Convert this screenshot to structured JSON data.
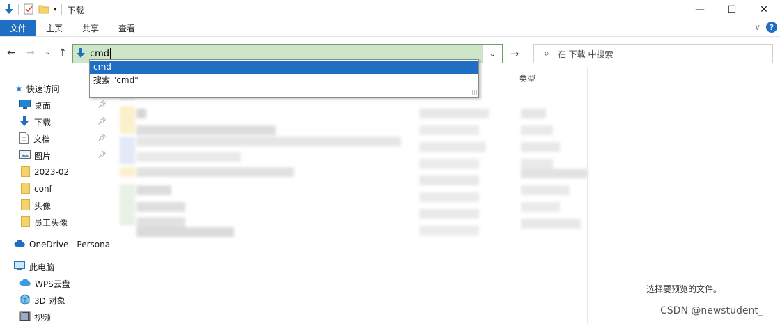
{
  "window": {
    "title": "下载",
    "controls": {
      "minimize": "—",
      "maximize": "☐",
      "close": "✕"
    }
  },
  "ribbon": {
    "tabs": [
      {
        "label": "文件"
      },
      {
        "label": "主页"
      },
      {
        "label": "共享"
      },
      {
        "label": "查看"
      }
    ],
    "expand": "∨",
    "help": "?"
  },
  "nav": {
    "back": "←",
    "forward": "→",
    "recent": "⌄",
    "up": "↑",
    "address_value": "cmd",
    "address_dropdown": "⌄",
    "go": "→",
    "search_icon": "⌕",
    "search_placeholder": "在 下载 中搜索"
  },
  "autocomplete": {
    "items": [
      {
        "label": "cmd",
        "selected": true
      },
      {
        "label": "搜索 \"cmd\"",
        "selected": false
      }
    ]
  },
  "sidebar": {
    "quick_access": "快速访问",
    "items": [
      {
        "label": "桌面",
        "icon": "desktop-icon",
        "pinned": true
      },
      {
        "label": "下载",
        "icon": "download-icon",
        "pinned": true
      },
      {
        "label": "文档",
        "icon": "document-icon",
        "pinned": true
      },
      {
        "label": "图片",
        "icon": "picture-icon",
        "pinned": true
      },
      {
        "label": "2023-02",
        "icon": "folder-icon",
        "pinned": false
      },
      {
        "label": "conf",
        "icon": "folder-icon",
        "pinned": false
      },
      {
        "label": "头像",
        "icon": "folder-icon",
        "pinned": false
      },
      {
        "label": "员工头像",
        "icon": "folder-icon",
        "pinned": false
      }
    ],
    "onedrive": "OneDrive - Persona",
    "this_pc": "此电脑",
    "pc_items": [
      {
        "label": "WPS云盘",
        "icon": "cloud-icon"
      },
      {
        "label": "3D 对象",
        "icon": "3d-objects-icon"
      },
      {
        "label": "视频",
        "icon": "video-icon"
      }
    ]
  },
  "file_list": {
    "type_header": "类型"
  },
  "preview": {
    "message": "选择要预览的文件。"
  },
  "watermark": "CSDN @newstudent_",
  "colors": {
    "accent": "#1f6ec4",
    "address_bg": "#cde5c9",
    "folder": "#f5d26b"
  }
}
